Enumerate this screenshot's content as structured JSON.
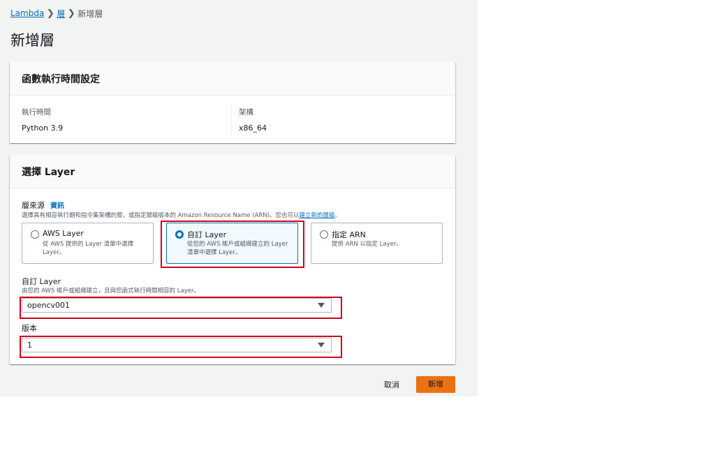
{
  "breadcrumb": {
    "items": [
      "Lambda",
      "層"
    ],
    "current": "新增層"
  },
  "page_title": "新增層",
  "runtime_settings": {
    "title": "函數執行時間設定",
    "runtime_label": "執行時間",
    "runtime_value": "Python 3.9",
    "arch_label": "架構",
    "arch_value": "x86_64"
  },
  "choose_layer": {
    "title": "選擇 Layer",
    "source_label": "層來源",
    "info_label": "資訊",
    "source_desc_prefix": "選擇具有相容執行期和指令集架構的層，或指定層級版本的 Amazon Resource Name (ARN)。您也可以",
    "source_desc_link": "建立新的層級",
    "source_desc_suffix": "。",
    "options": [
      {
        "title": "AWS Layer",
        "desc": "從 AWS 提供的 Layer 清單中選擇 Layer。",
        "selected": false
      },
      {
        "title": "自訂 Layer",
        "desc": "從您的 AWS 帳戶或組織建立的 Layer 清單中選擇 Layer。",
        "selected": true
      },
      {
        "title": "指定 ARN",
        "desc": "提供 ARN 以指定 Layer。",
        "selected": false
      }
    ],
    "custom_layer_label": "自訂 Layer",
    "custom_layer_desc": "由您的 AWS 帳戶或組織建立，且與您函式執行時間相容的 Layer。",
    "custom_layer_value": "opencv001",
    "version_label": "版本",
    "version_value": "1"
  },
  "actions": {
    "cancel_label": "取消",
    "add_label": "新增"
  },
  "colors": {
    "accent": "#0073bb",
    "primary_button": "#ec7211",
    "highlight_box": "#d0021b"
  }
}
